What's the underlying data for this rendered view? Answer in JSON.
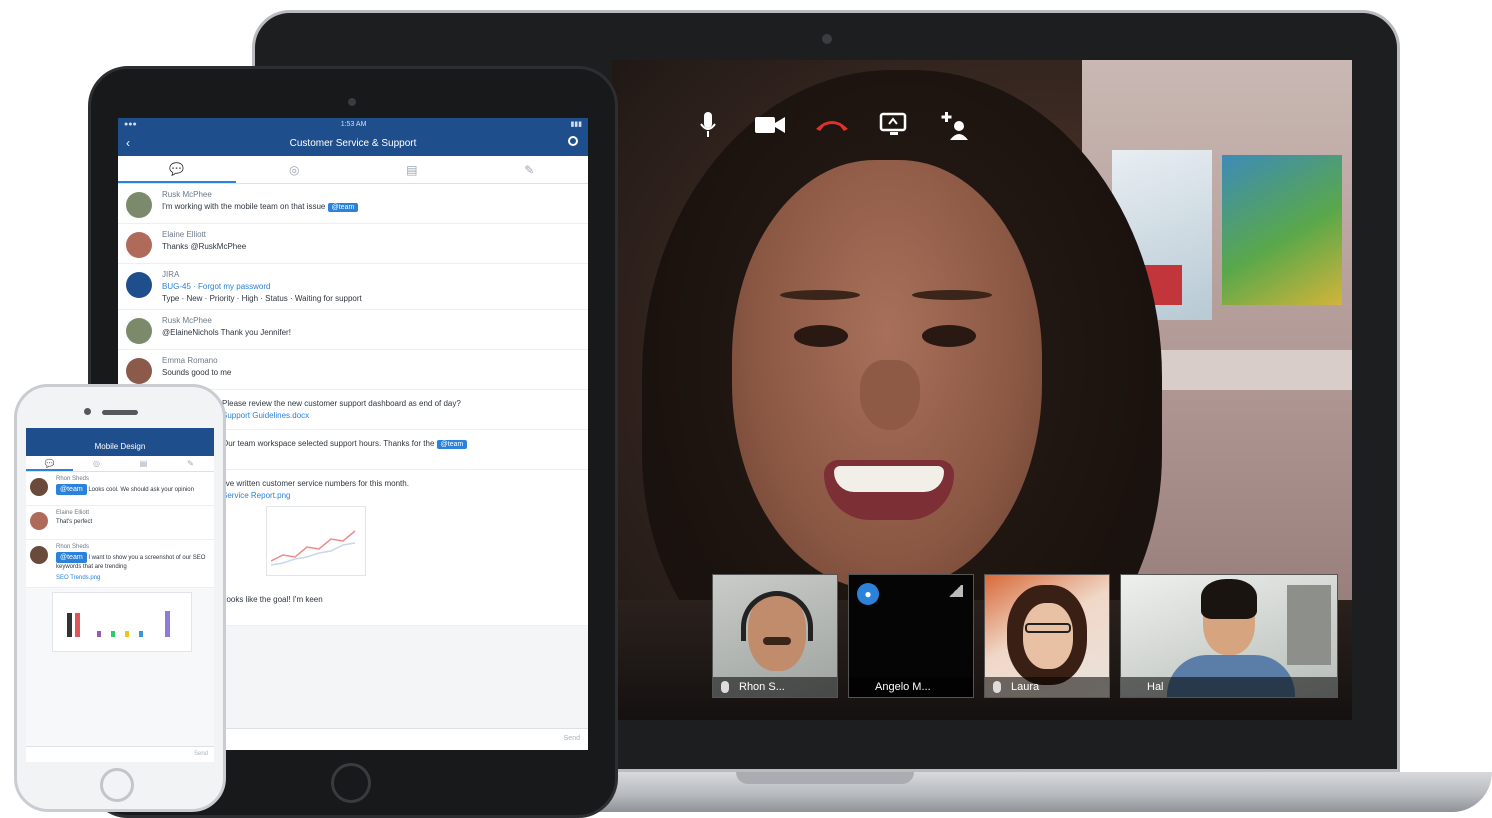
{
  "video_call": {
    "controls": [
      {
        "name": "microphone-icon",
        "glyph": "🎤"
      },
      {
        "name": "camera-icon",
        "glyph": "▬"
      },
      {
        "name": "end-call-icon",
        "glyph": "☎"
      },
      {
        "name": "screen-share-icon",
        "glyph": "▭"
      },
      {
        "name": "add-participant-icon",
        "glyph": "➕"
      }
    ],
    "participants": [
      {
        "name": "Rhon S..."
      },
      {
        "name": "Angelo M..."
      },
      {
        "name": "Laura"
      },
      {
        "name": "Hal"
      }
    ],
    "end_call_color": "#e0322b"
  },
  "tablet": {
    "status_time": "1:53 AM",
    "title": "Customer Service & Support",
    "messages": [
      {
        "who": "Rusk McPhee",
        "text": "I'm working with the mobile team on that issue",
        "chip": "@team"
      },
      {
        "who": "Elaine Elliott",
        "text": "Thanks @RuskMcPhee"
      },
      {
        "who": "JIRA",
        "text": "BUG-45 · Forgot my password",
        "extra": "Type · New · Priority · High · Status · Waiting for support"
      },
      {
        "who": "Rusk McPhee",
        "text": "@ElaineNichols Thank you Jennifer!"
      },
      {
        "who": "Emma Romano",
        "text": "Sounds good to me"
      },
      {
        "who": "",
        "text": "Please review the new customer support dashboard as end of day?"
      },
      {
        "who": "",
        "text": "Support Guidelines.docx"
      },
      {
        "who": "",
        "text": "Our team workspace selected support hours. Thanks for the",
        "chip": "@team"
      },
      {
        "who": "",
        "text": "I've written customer service numbers for this month."
      },
      {
        "who": "",
        "text": "Service Report.png"
      },
      {
        "who": "",
        "text": "Looks like the goal! I'm keen"
      }
    ],
    "compose_hint": "Send"
  },
  "phone": {
    "title": "Mobile Design",
    "messages": [
      {
        "who": "Rhon Sheds",
        "text": "Looks cool. We should ask your opinion",
        "chip": "@team"
      },
      {
        "who": "Elaine Elliott",
        "text": "That's perfect"
      },
      {
        "who": "Rhon Sheds",
        "text": "I want to show you a screenshot of our SEO keywords that are trending",
        "chip": "@team"
      },
      {
        "who": "",
        "text": "SEO Trends.png"
      }
    ],
    "compose_hint": "Send"
  }
}
